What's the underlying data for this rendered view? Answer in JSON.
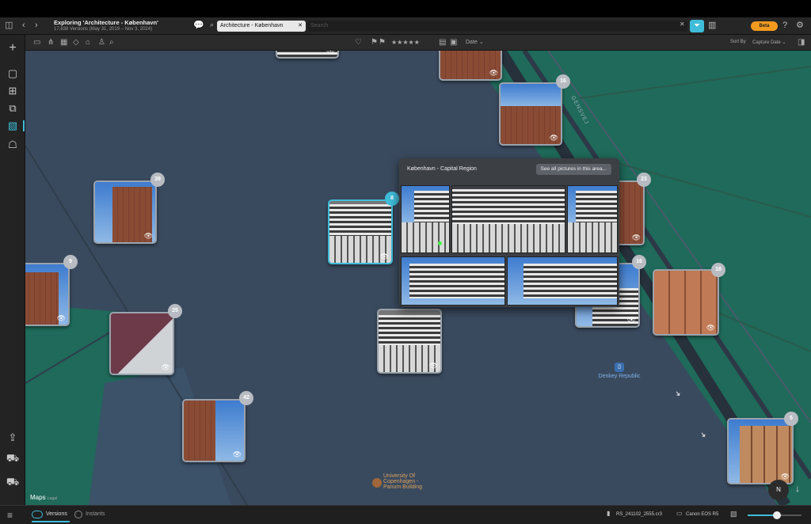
{
  "window": {
    "title": "Exploring 'Architecture - København'",
    "subtitle": "17,638 Versions (May 31, 2019 – Nov 3, 2024)",
    "search_token": "Architecture - København",
    "search_placeholder": "Search",
    "beta_label": "Beta"
  },
  "toolbar": {
    "rating_stars": "★★★★★",
    "sort_field": "Date",
    "sort_label": "Sort By",
    "sort_value": "Capture Date"
  },
  "map": {
    "popover": {
      "region": "København - Capital Region",
      "button": "See all pictures in this area..."
    },
    "badges": {
      "b1": "16",
      "b2": "39",
      "b3": "9",
      "b4": "25",
      "b5": "42",
      "b6": "8",
      "b7": "23",
      "b8": "16",
      "b9": "18",
      "b10": "5"
    },
    "poi1": "Denkey Republic",
    "poi2": "University Of Copenhagen - Panum Building",
    "road": "GENSVEJ",
    "attribution": "Maps",
    "legal": "Legal",
    "compass": "N"
  },
  "bottom": {
    "versions": "Versions",
    "instants": "Instants",
    "filename": "RS_241102_2555.cr3",
    "camera": "Canon EOS R5"
  },
  "colors": {
    "accent": "#3fbcd9",
    "beta": "#f29a1f",
    "water": "#3a4a5e",
    "park": "#1f6a5a"
  }
}
